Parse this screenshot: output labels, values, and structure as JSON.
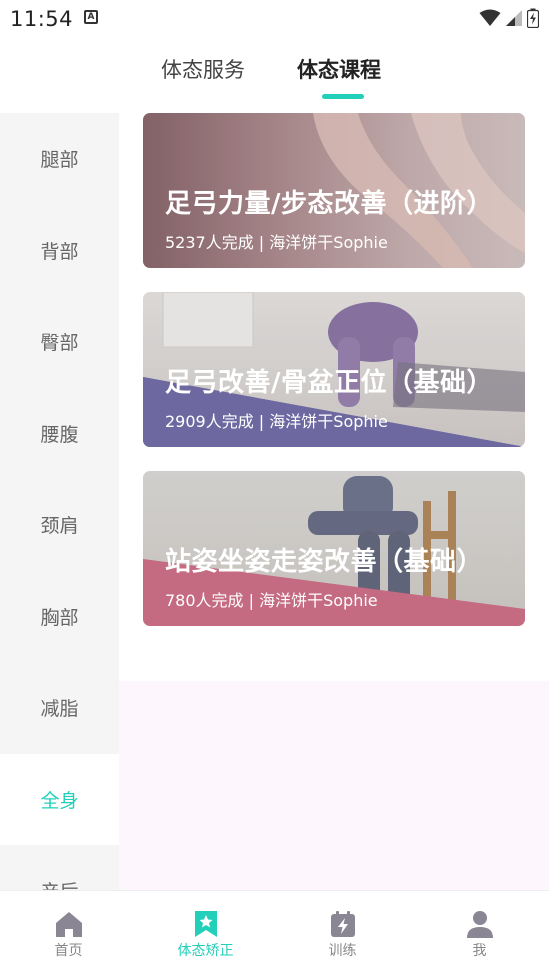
{
  "status_bar": {
    "time": "11:54",
    "notification_badge": "A"
  },
  "top_tabs": [
    {
      "label": "体态服务"
    },
    {
      "label": "体态课程"
    }
  ],
  "sidebar": {
    "items": [
      {
        "label": "腿部"
      },
      {
        "label": "背部"
      },
      {
        "label": "臀部"
      },
      {
        "label": "腰腹"
      },
      {
        "label": "颈肩"
      },
      {
        "label": "胸部"
      },
      {
        "label": "减脂"
      },
      {
        "label": "全身"
      },
      {
        "label": "产后"
      }
    ],
    "active": "全身"
  },
  "courses": [
    {
      "title": "足弓力量/步态改善（进阶）",
      "subtitle": "5237人完成 | 海洋饼干Sophie"
    },
    {
      "title": "足弓改善/骨盆正位（基础）",
      "subtitle": "2909人完成 | 海洋饼干Sophie"
    },
    {
      "title": "站姿坐姿走姿改善（基础）",
      "subtitle": "780人完成 | 海洋饼干Sophie"
    }
  ],
  "bottom_nav": [
    {
      "label": "首页",
      "icon": "home-icon"
    },
    {
      "label": "体态矫正",
      "icon": "star-bookmark-icon"
    },
    {
      "label": "训练",
      "icon": "lightning-icon"
    },
    {
      "label": "我",
      "icon": "person-icon"
    }
  ],
  "colors": {
    "accent": "#22cfb9",
    "card2_band": "#7470aa",
    "card3_band": "#cf7088"
  }
}
